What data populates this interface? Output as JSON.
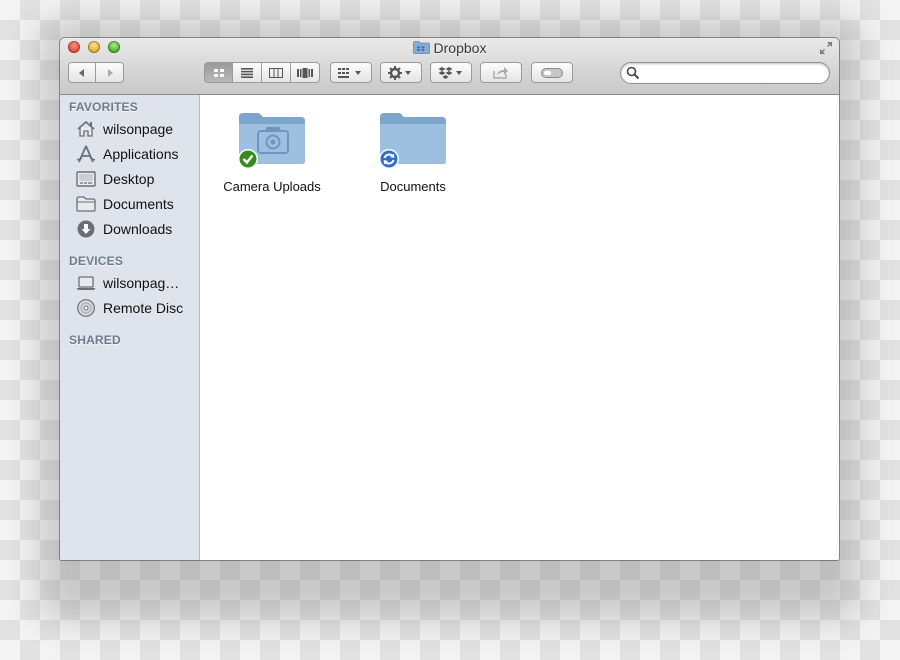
{
  "window": {
    "title": "Dropbox",
    "title_icon": "dropbox-folder-icon",
    "traffic_lights": {
      "close": "#e2463b",
      "minimize": "#e3a52a",
      "zoom": "#3fae2a"
    }
  },
  "toolbar": {
    "back_icon": "back-arrow-icon",
    "forward_icon": "forward-arrow-icon",
    "view_modes": [
      "icon-view",
      "list-view",
      "column-view",
      "cover-flow-view"
    ],
    "active_view": "icon-view",
    "arrange_icon": "arrange-menu-icon",
    "action_icon": "gear-icon",
    "dropbox_icon": "dropbox-icon",
    "share_icon": "share-icon",
    "tags_icon": "tag-toggle-icon",
    "search": {
      "value": "",
      "placeholder": ""
    }
  },
  "sidebar": {
    "favorites_title": "FAVORITES",
    "favorites": [
      {
        "label": "wilsonpage",
        "icon": "home-icon"
      },
      {
        "label": "Applications",
        "icon": "applications-icon"
      },
      {
        "label": "Desktop",
        "icon": "desktop-icon"
      },
      {
        "label": "Documents",
        "icon": "folder-icon"
      },
      {
        "label": "Downloads",
        "icon": "downloads-icon"
      }
    ],
    "devices_title": "DEVICES",
    "devices": [
      {
        "label": "wilsonpag…",
        "icon": "laptop-icon"
      },
      {
        "label": "Remote Disc",
        "icon": "disc-icon"
      }
    ],
    "shared_title": "SHARED"
  },
  "files": [
    {
      "name": "Camera Uploads",
      "icon": "camera-folder-icon",
      "badge": "synced-check-icon",
      "badge_color": "#3a8a1e"
    },
    {
      "name": "Documents",
      "icon": "folder-icon",
      "badge": "syncing-icon",
      "badge_color": "#2e6fc9"
    }
  ],
  "colors": {
    "sidebar_bg": "#dfe4ec",
    "section_title": "#6e7b8e",
    "folder_blue": "#8fb4d6"
  }
}
